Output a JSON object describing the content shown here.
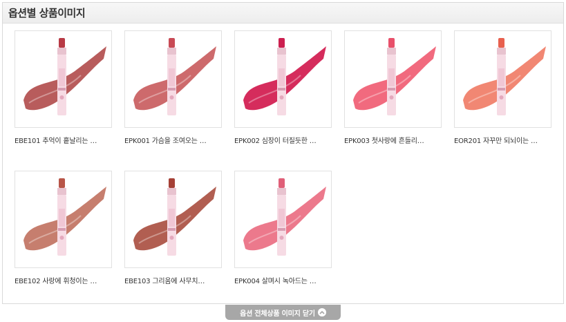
{
  "panel": {
    "title": "옵션별 상품이미지"
  },
  "products": [
    {
      "label": "EBE101 추억이 흩날리는 …",
      "swatch": "#b04a4a",
      "cap": "#b83a45"
    },
    {
      "label": "EPK001 가슴을 조여오는 …",
      "swatch": "#c85a5c",
      "cap": "#c84a55"
    },
    {
      "label": "EPK002 심장이 터질듯한 …",
      "swatch": "#d0154a",
      "cap": "#cc1f4f"
    },
    {
      "label": "EPK003 첫사랑에 흔들리…",
      "swatch": "#f05a70",
      "cap": "#e8506a"
    },
    {
      "label": "EOR201 자꾸만 되뇌이는 …",
      "swatch": "#f07a64",
      "cap": "#e8604e"
    },
    {
      "label": "EBE102 사랑에 휘청이는 …",
      "swatch": "#c0705e",
      "cap": "#b85548"
    },
    {
      "label": "EBE103 그리움에 사무치…",
      "swatch": "#a84c3e",
      "cap": "#a54036"
    },
    {
      "label": "EPK004 살며시 녹아드는 …",
      "swatch": "#ea6a80",
      "cap": "#e05f78"
    }
  ],
  "footer": {
    "close_label": "옵션 전체상품 이미지 닫기",
    "close_icon": "chevron-up-icon"
  }
}
